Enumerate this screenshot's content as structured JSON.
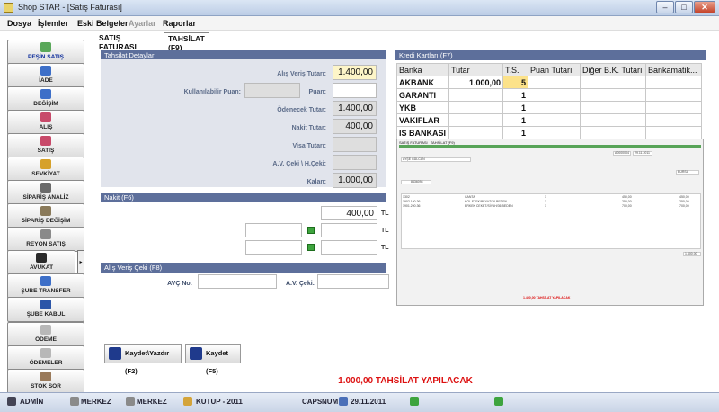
{
  "window": {
    "title": "Shop STAR - [Satış Faturası]"
  },
  "menu": [
    "Dosya",
    "İşlemler",
    "Eski Belgeler",
    "Ayarlar",
    "Raporlar"
  ],
  "sidebar": [
    {
      "label": "PEŞİN SATIŞ"
    },
    {
      "label": "İADE"
    },
    {
      "label": "DEĞİŞİM"
    },
    {
      "label": "ALIŞ"
    },
    {
      "label": "SATIŞ"
    },
    {
      "label": "SEVKİYAT"
    },
    {
      "label": "SİPARİŞ ANALİZ"
    },
    {
      "label": "SİPARİŞ DEĞİŞİM"
    },
    {
      "label": "REYON SATIŞ"
    },
    {
      "label": "AVUKAT"
    },
    {
      "label": "ŞUBE TRANSFER"
    },
    {
      "label": "ŞUBE KABUL"
    },
    {
      "label": "ÖDEME"
    },
    {
      "label": "ÖDEMELER"
    },
    {
      "label": "STOK SOR"
    }
  ],
  "tabs": [
    {
      "label": "SATIŞ FATURASI"
    },
    {
      "label": "TAHSİLAT (F9)"
    }
  ],
  "tahsilat": {
    "header": "Tahsilat Detayları",
    "alis_veris_tutari_label": "Alış Veriş Tutarı:",
    "alis_veris_tutari": "1.400,00",
    "kullanilabilir_puan_label": "Kullanılabilir Puan:",
    "puan_label": "Puan:",
    "odenecek_tutar_label": "Ödenecek Tutar:",
    "odenecek_tutar": "1.400,00",
    "nakit_tutar_label": "Nakit Tutar:",
    "nakit_tutar": "400,00",
    "visa_tutari_label": "Visa Tutarı:",
    "avceki_label": "A.V. Çeki \\ H.Çeki:",
    "kalan_label": "Kalan:",
    "kalan": "1.000,00"
  },
  "nakit": {
    "header": "Nakit (F6)",
    "value": "400,00",
    "tl": "TL"
  },
  "alis_veris_ceki": {
    "header": "Alış Veriş Çeki (F8)",
    "avc_no_label": "AVÇ No:",
    "av_ceki_label": "A.V. Çeki:"
  },
  "buttons": {
    "kaydet_yazdir": "Kaydet\\Yazdır (F2)",
    "kaydet": "Kaydet (F5)"
  },
  "kredi": {
    "header": "Kredi Kartları (F7)",
    "columns": [
      "Banka",
      "Tutar",
      "T.S.",
      "Puan Tutarı",
      "Diğer B.K. Tutarı",
      "Bankamatik..."
    ],
    "rows": [
      {
        "banka": "AKBANK",
        "tutar": "1.000,00",
        "ts": "5"
      },
      {
        "banka": "GARANTI",
        "tutar": "",
        "ts": "1"
      },
      {
        "banka": "YKB",
        "tutar": "",
        "ts": "1"
      },
      {
        "banka": "VAKIFLAR",
        "tutar": "",
        "ts": "1"
      },
      {
        "banka": "IS BANKASI",
        "tutar": "",
        "ts": "1"
      }
    ]
  },
  "embedded": {
    "tabs": [
      "SATIŞ FATURASI",
      "TAHSİLAT (F9)"
    ],
    "customer": "AYŞE GÜLCAN",
    "fatura_no": "A0000004",
    "date": "29.11.2011",
    "city": "BURSA",
    "code": "8436094",
    "rows": [
      {
        "no": "1302",
        "name": "ÇANTA",
        "qty": "1",
        "amount": "450,00"
      },
      {
        "no": "1902.100.36",
        "name": "KOL ETEK/BEYAZ/36 BEDEN",
        "qty": "1",
        "amount": "250,00"
      },
      {
        "no": "1901.200.36",
        "name": "ERKEK CEKET/SİYAH/36 BEDEN",
        "qty": "1",
        "amount": "700,00"
      }
    ],
    "toplam": "1.400,00",
    "message": "1.400,00 TAHSİLAT YAPILACAK"
  },
  "footer_message": "1.000,00 TAHSİLAT YAPILACAK",
  "status": {
    "user": "ADMİN",
    "store1": "MERKEZ",
    "store2": "MERKEZ",
    "period": "KUTUP - 2011",
    "caps": "CAPS",
    "num": "NUM",
    "date": "29.11.2011"
  }
}
